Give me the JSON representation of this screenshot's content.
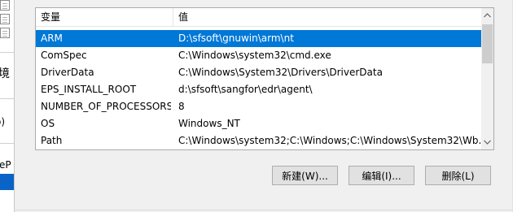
{
  "left_panel": {
    "fragment_env": "境",
    "fragment_radio": "o)",
    "fragment_module": "uleP"
  },
  "env_list": {
    "columns": [
      "变量",
      "值"
    ],
    "rows": [
      {
        "name": "ARM",
        "value": "D:\\sfsoft\\gnuwin\\arm\\nt",
        "selected": true
      },
      {
        "name": "ComSpec",
        "value": "C:\\Windows\\system32\\cmd.exe",
        "selected": false
      },
      {
        "name": "DriverData",
        "value": "C:\\Windows\\System32\\Drivers\\DriverData",
        "selected": false
      },
      {
        "name": "EPS_INSTALL_ROOT",
        "value": "d:\\sfsoft\\sangfor\\edr\\agent\\",
        "selected": false
      },
      {
        "name": "NUMBER_OF_PROCESSORS",
        "value": "8",
        "selected": false
      },
      {
        "name": "OS",
        "value": "Windows_NT",
        "selected": false
      },
      {
        "name": "Path",
        "value": "C:\\Windows\\system32;C:\\Windows;C:\\Windows\\System32\\Wb...",
        "selected": false
      }
    ],
    "scroll_up_icon": "chevron-up-icon",
    "scroll_down_icon": "chevron-down-icon"
  },
  "buttons": {
    "new_label": "新建(W)...",
    "edit_label": "编辑(I)...",
    "delete_label": "删除(L)"
  },
  "colors": {
    "selection": "#0078d7",
    "background": "#f0f0f0",
    "button_face": "#e1e1e1"
  }
}
